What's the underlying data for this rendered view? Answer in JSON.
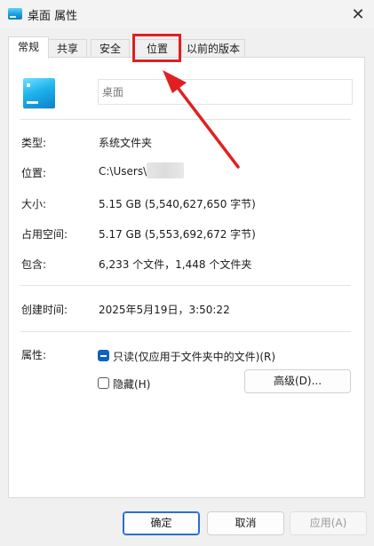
{
  "window": {
    "title": "桌面 属性",
    "close_glyph": "✕"
  },
  "tabs": [
    {
      "label": "常规",
      "active": true
    },
    {
      "label": "共享",
      "active": false
    },
    {
      "label": "安全",
      "active": false
    },
    {
      "label": "位置",
      "active": false
    },
    {
      "label": "以前的版本",
      "active": false
    }
  ],
  "general": {
    "icon": "folder-icon",
    "name_value": "桌面",
    "type_label": "类型:",
    "type_value": "系统文件夹",
    "location_label": "位置:",
    "location_value": "C:\\Users\\",
    "size_label": "大小:",
    "size_value": "5.15 GB (5,540,627,650 字节)",
    "disk_size_label": "占用空间:",
    "disk_size_value": "5.17 GB (5,553,692,672 字节)",
    "contains_label": "包含:",
    "contains_value": "6,233 个文件，1,448 个文件夹",
    "created_label": "创建时间:",
    "created_value": "2025年5月19日，3:50:22",
    "attributes_label": "属性:",
    "readonly_label": "只读(仅应用于文件夹中的文件)(R)",
    "readonly_state": "indeterminate",
    "hidden_label": "隐藏(H)",
    "hidden_checked": false,
    "advanced_label": "高级(D)..."
  },
  "footer": {
    "ok_label": "确定",
    "cancel_label": "取消",
    "apply_label": "应用(A)"
  },
  "colors": {
    "accent": "#0f62c4",
    "annotation": "#e02020"
  }
}
